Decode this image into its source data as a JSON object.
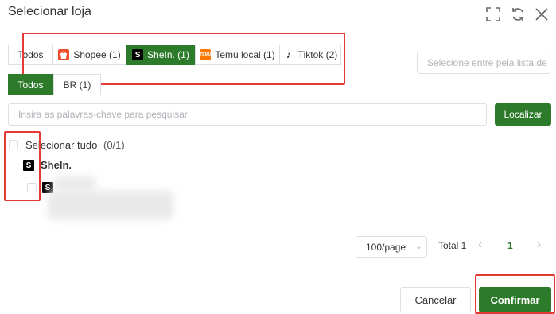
{
  "header": {
    "title": "Selecionar loja",
    "icons": [
      "fullscreen-icon",
      "refresh-icon",
      "close-icon"
    ]
  },
  "platform_tabs": [
    {
      "label": "Todos",
      "logo": "",
      "active": false
    },
    {
      "label": "Shopee (1)",
      "logo": "shopee-bag",
      "active": false
    },
    {
      "label": "SheIn. (1)",
      "logo": "S",
      "active": true
    },
    {
      "label": "Temu local (1)",
      "logo": "TEMU",
      "active": false
    },
    {
      "label": "Tiktok (2)",
      "logo": "tiktok-note",
      "active": false
    }
  ],
  "store_select": {
    "placeholder": "Selecione entre pela lista de"
  },
  "region_tabs": [
    {
      "label": "Todos",
      "active": true
    },
    {
      "label": "BR (1)",
      "active": false
    }
  ],
  "search": {
    "placeholder": "Insira as palavras-chave para pesquisar",
    "button_label": "Localizar"
  },
  "list": {
    "select_all_label": "Selecionar tudo",
    "select_all_count": "(0/1)",
    "group_logo": "S",
    "group_label": "SheIn.",
    "item_logo": "S"
  },
  "pagination": {
    "page_size": "100/page",
    "total": "Total 1",
    "prev": "‹",
    "current_page": "1",
    "next": "›"
  },
  "footer": {
    "cancel_label": "Cancelar",
    "confirm_label": "Confirmar"
  },
  "colors": {
    "primary": "#2c7a2a",
    "highlight": "#e53935"
  }
}
